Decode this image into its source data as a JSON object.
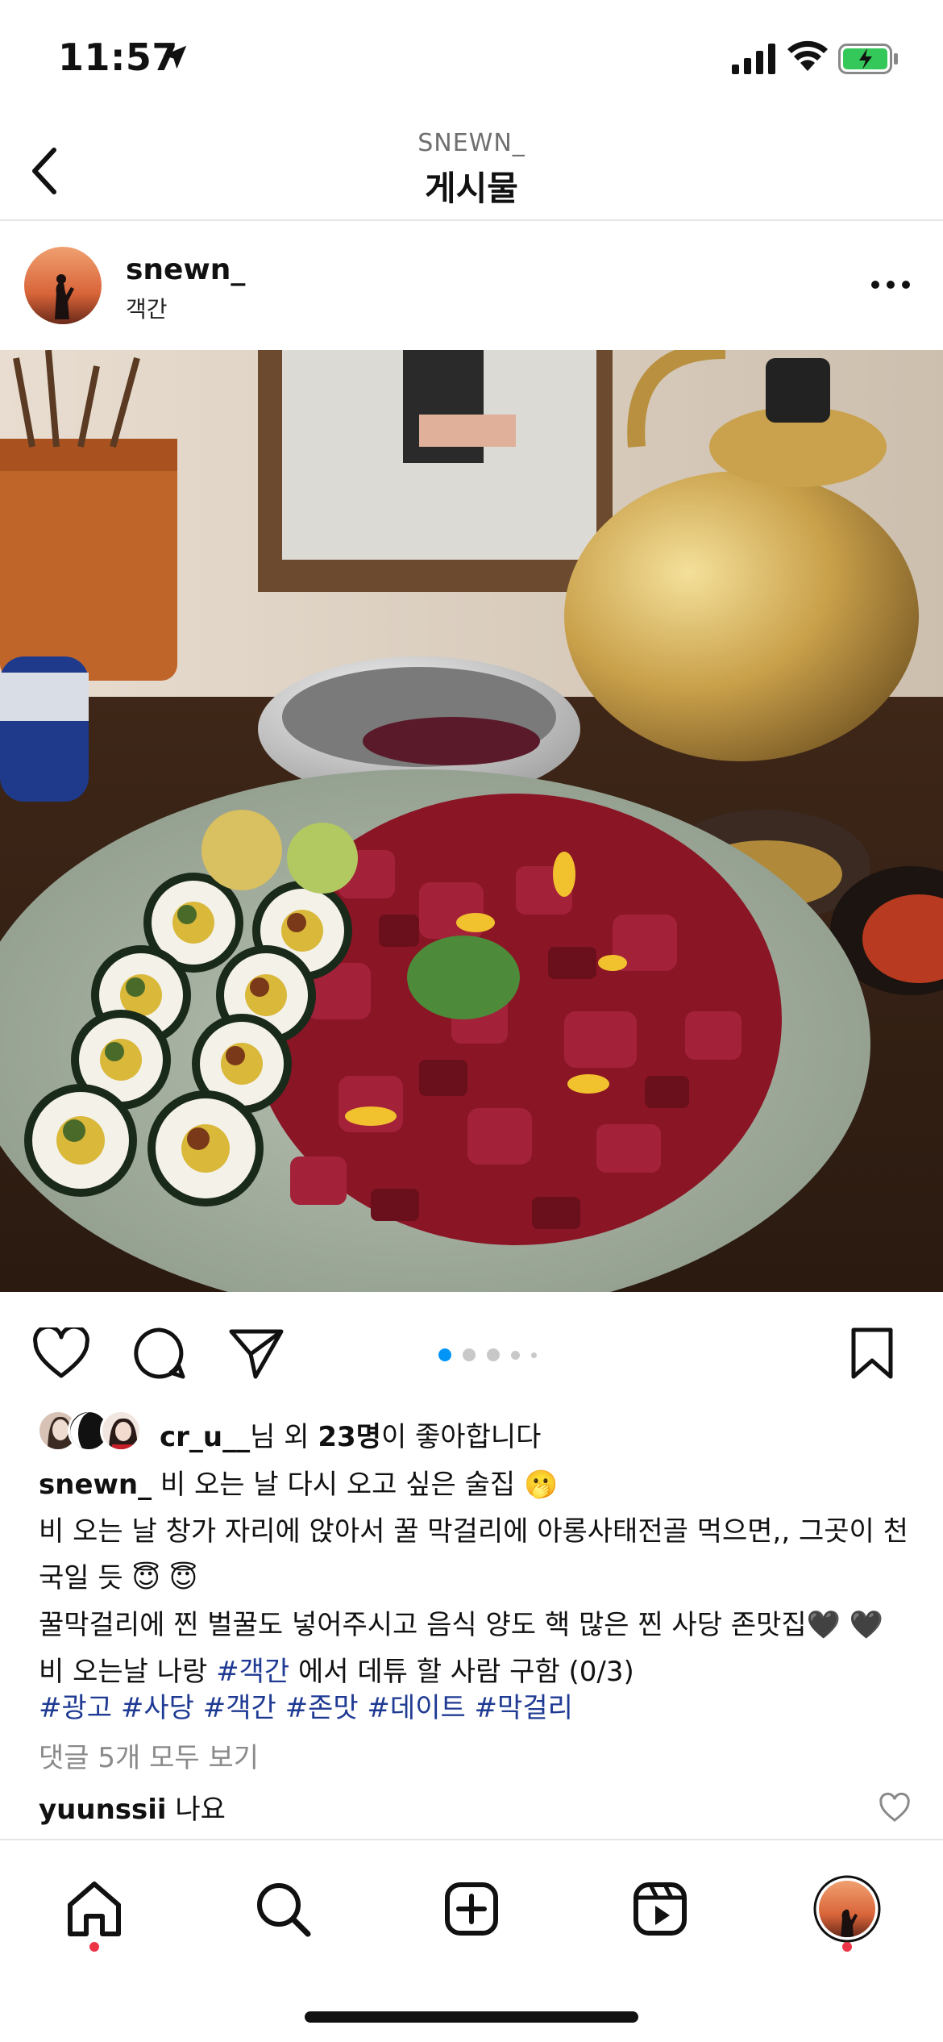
{
  "status_bar": {
    "time": "11:57"
  },
  "header": {
    "account": "SNEWN_",
    "title": "게시물"
  },
  "post": {
    "username": "snewn_",
    "location": "객간",
    "carousel": {
      "count": 5,
      "active_index": 0
    }
  },
  "likes": {
    "user": "cr_u__",
    "mid": "님 외 ",
    "count": "23명",
    "suffix": "이 좋아합니다"
  },
  "caption": {
    "username": "snewn_",
    "line1": " 비 오는 날 다시 오고 싶은 술집",
    "line1_emoji": "🫢",
    "line2": "비 오는 날 창가 자리에 앉아서 꿀 막걸리에 아롱사태전골 먹으면,, 그곳이 천국일 듯 ",
    "line2_emoji": "😇 😇",
    "line3": "꿀막걸리에 찐 벌꿀도 넣어주시고 음식 양도 핵 많은 찐 사당 존맛집",
    "line3_emoji": "🖤 🖤",
    "line4_pre": "비 오는날 나랑 ",
    "line4_tag": "#객간",
    "line4_post": " 에서 데튜 할 사람 구함 (0/3)"
  },
  "hashtags": "#광고 #사당 #객간 #존맛 #데이트 #막걸리",
  "view_comments": "댓글 5개 모두 보기",
  "comment": {
    "username": "yuunssii",
    "text": " 나요"
  },
  "colors": {
    "accent": "#0095f6",
    "tag": "#1f3a93",
    "notification": "#ed3446"
  }
}
